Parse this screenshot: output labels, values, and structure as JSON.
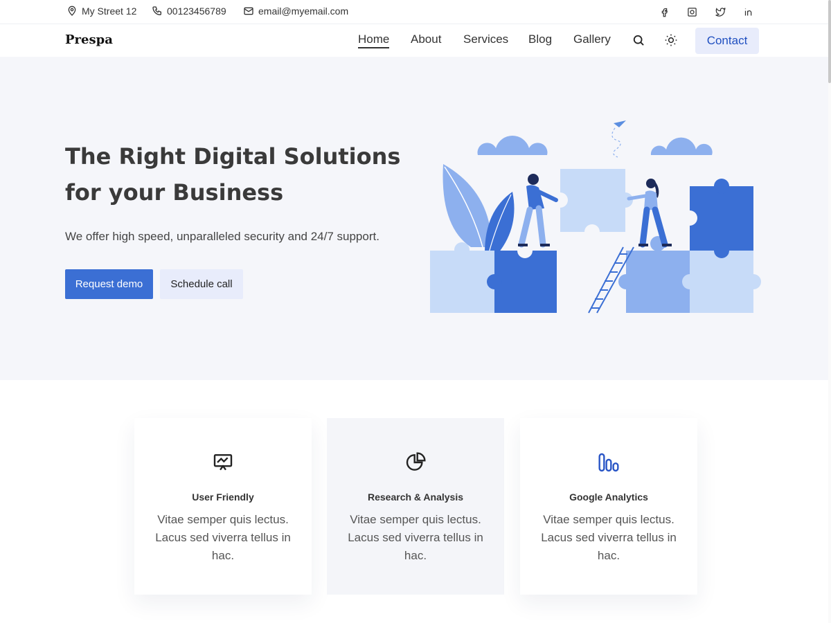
{
  "topbar": {
    "address": "My Street 12",
    "phone": "00123456789",
    "email": "email@myemail.com",
    "social": [
      "facebook-icon",
      "instagram-icon",
      "twitter-icon",
      "linkedin-icon"
    ]
  },
  "nav": {
    "brand": "Prespa",
    "links": [
      "Home",
      "About",
      "Services",
      "Blog",
      "Gallery"
    ],
    "active": "Home",
    "contact": "Contact"
  },
  "hero": {
    "title": "The Right Digital Solutions for your Business",
    "subtitle": "We offer high speed, unparalleled security and 24/7 support.",
    "primary_button": "Request demo",
    "secondary_button": "Schedule call"
  },
  "features": [
    {
      "title": "User Friendly",
      "description": "Vitae semper quis lectus. Lacus sed viverra tellus in hac.",
      "icon": "presentation-chart-icon"
    },
    {
      "title": "Research & Analysis",
      "description": "Vitae semper quis lectus. Lacus sed viverra tellus in hac.",
      "icon": "pie-chart-icon"
    },
    {
      "title": "Google Analytics",
      "description": "Vitae semper quis lectus. Lacus sed viverra tellus in hac.",
      "icon": "analytics-bars-icon"
    }
  ],
  "colors": {
    "accent": "#3b6fd4",
    "accent_light": "#e8ecfb",
    "hero_bg": "#f5f6fa"
  }
}
